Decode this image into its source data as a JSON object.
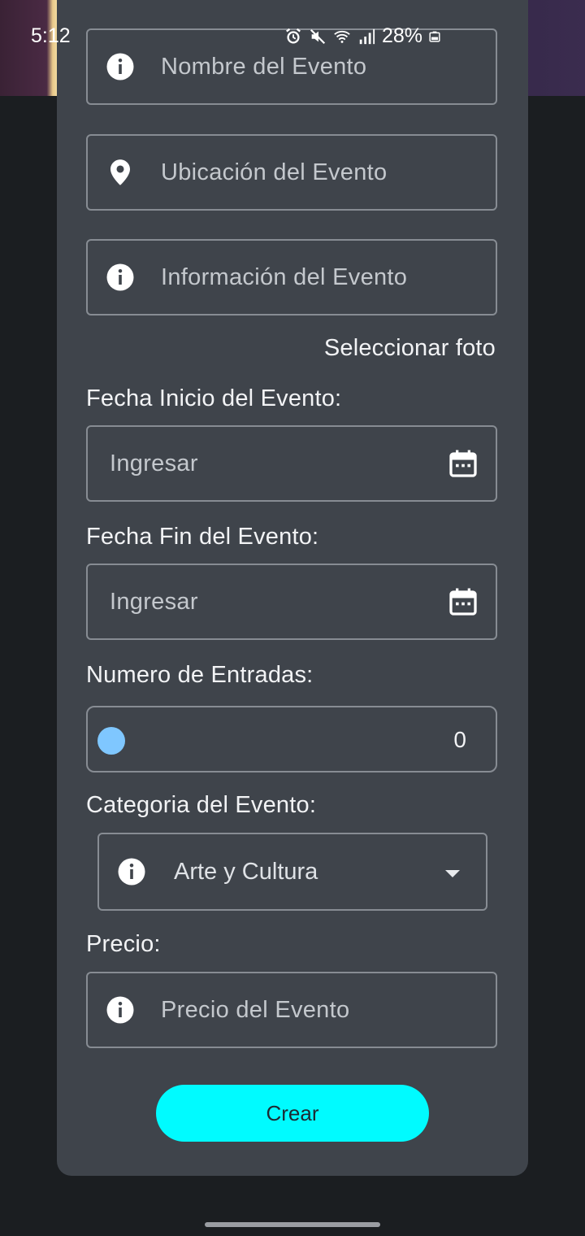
{
  "status_bar": {
    "time": "5:12",
    "battery": "28%",
    "icons": [
      "alarm-icon",
      "mute-icon",
      "wifi-icon",
      "signal-icon",
      "battery-icon"
    ]
  },
  "form": {
    "event_name_placeholder": "Nombre del Evento",
    "event_location_placeholder": "Ubicación del Evento",
    "event_info_placeholder": "Información del Evento",
    "select_photo": "Seleccionar foto",
    "start_date_label": "Fecha Inicio del Evento:",
    "start_date_placeholder": "Ingresar",
    "end_date_label": "Fecha Fin del Evento:",
    "end_date_placeholder": "Ingresar",
    "tickets_label": "Numero de Entradas:",
    "tickets_value": "0",
    "category_label": "Categoria del Evento:",
    "category_selected": "Arte y Cultura",
    "price_label": "Precio:",
    "price_placeholder": "Precio del Evento",
    "create_button": "Crear"
  },
  "colors": {
    "card_background": "#3f444b",
    "accent_button": "#00fbff",
    "slider_thumb": "#7fc7ff"
  }
}
